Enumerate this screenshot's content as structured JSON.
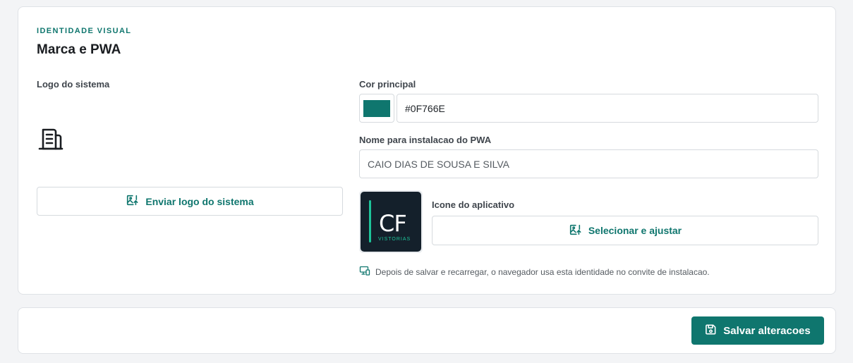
{
  "section": {
    "eyebrow": "IDENTIDADE VISUAL",
    "title": "Marca e PWA"
  },
  "logo": {
    "label": "Logo do sistema",
    "preview_icon": "building-icon",
    "upload_button": "Enviar logo do sistema",
    "upload_icon": "image-upload-icon"
  },
  "color": {
    "label": "Cor principal",
    "value": "#0F766E"
  },
  "pwa_name": {
    "label": "Nome para instalacao do PWA",
    "value": "CAIO DIAS DE SOUSA E SILVA"
  },
  "app_icon": {
    "letters": "CF",
    "subtitle": "VISTORIAS",
    "label": "Icone do aplicativo",
    "button": "Selecionar e ajustar",
    "button_icon": "image-upload-icon"
  },
  "hint": {
    "icon": "devices-icon",
    "text": "Depois de salvar e recarregar, o navegador usa esta identidade no convite de instalacao."
  },
  "footer": {
    "save_button": "Salvar alteracoes",
    "save_icon": "save-icon"
  },
  "colors": {
    "accent": "#0F766E",
    "icon_background": "#14202B",
    "icon_accent": "#1DC49A"
  }
}
